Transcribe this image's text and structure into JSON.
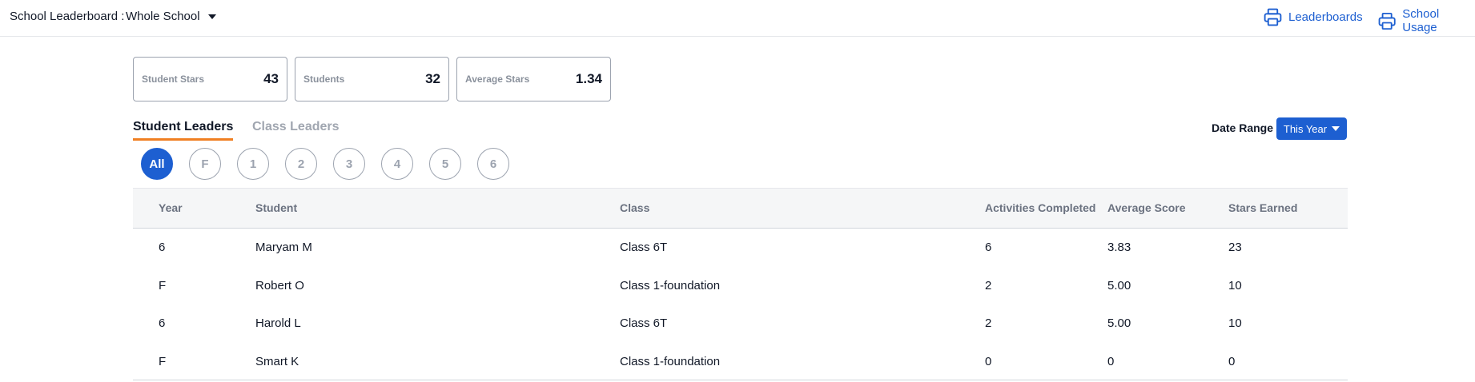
{
  "header": {
    "scope_label": "School Leaderboard :",
    "scope_value": "Whole School",
    "links": [
      {
        "label": "Leaderboards",
        "icon": "printer-icon"
      },
      {
        "label": "School Usage",
        "icon": "printer-icon"
      }
    ]
  },
  "stats": [
    {
      "label": "Student Stars",
      "value": "43"
    },
    {
      "label": "Students",
      "value": "32"
    },
    {
      "label": "Average Stars",
      "value": "1.34"
    }
  ],
  "tabs": [
    {
      "label": "Student Leaders",
      "active": true
    },
    {
      "label": "Class Leaders",
      "active": false
    }
  ],
  "date_range": {
    "label": "Date Range",
    "value": "This Year"
  },
  "year_filters": [
    "All",
    "F",
    "1",
    "2",
    "3",
    "4",
    "5",
    "6"
  ],
  "table": {
    "columns": [
      "Year",
      "Student",
      "Class",
      "Activities Completed",
      "Average Score",
      "Stars Earned"
    ],
    "rows": [
      [
        "6",
        "Maryam M",
        "Class 6T",
        "6",
        "3.83",
        "23"
      ],
      [
        "F",
        "Robert O",
        "Class 1-foundation",
        "2",
        "5.00",
        "10"
      ],
      [
        "6",
        "Harold L",
        "Class 6T",
        "2",
        "5.00",
        "10"
      ],
      [
        "F",
        "Smart K",
        "Class 1-foundation",
        "0",
        "0",
        "0"
      ]
    ]
  },
  "colors": {
    "accent": "#1d5fd1",
    "tab_underline": "#f07f22"
  }
}
